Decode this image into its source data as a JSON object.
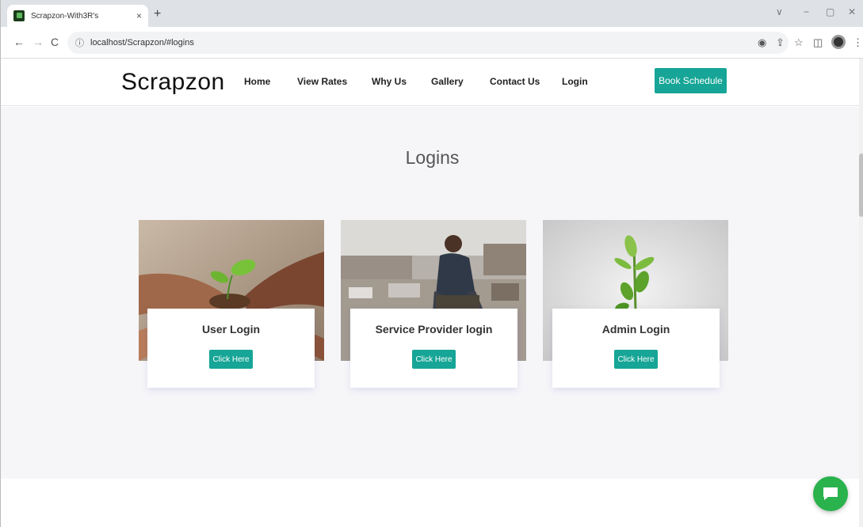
{
  "browser": {
    "tab_title": "Scrapzon-With3R's",
    "tab_close": "×",
    "new_tab": "+",
    "url": "localhost/Scrapzon/#logins",
    "back": "←",
    "forward": "→",
    "reload": "C",
    "info": "ⓘ",
    "win_dropdown": "∨",
    "win_min": "−",
    "win_max": "▢",
    "win_close": "✕",
    "star": "☆",
    "share": "⇪",
    "eye_off": "◉",
    "sidepanel": "◫",
    "menu": "⋮"
  },
  "header": {
    "logo": "Scrapzon",
    "nav": [
      {
        "label": "Home"
      },
      {
        "label": "View Rates"
      },
      {
        "label": "Why Us"
      },
      {
        "label": "Gallery"
      },
      {
        "label": "Contact Us"
      },
      {
        "label": "Login"
      }
    ],
    "book_button": "Book Schedule"
  },
  "main": {
    "title": "Logins",
    "cards": [
      {
        "title": "User Login",
        "button": "Click Here",
        "image": "hands-holding-seedling"
      },
      {
        "title": "Service Provider login",
        "button": "Click Here",
        "image": "man-sorting-scrap"
      },
      {
        "title": "Admin Login",
        "button": "Click Here",
        "image": "plant-sprout"
      }
    ]
  },
  "colors": {
    "accent": "#16a596",
    "chat": "#2ab24c"
  },
  "icons": {
    "chat": "chat-bubble-icon"
  }
}
